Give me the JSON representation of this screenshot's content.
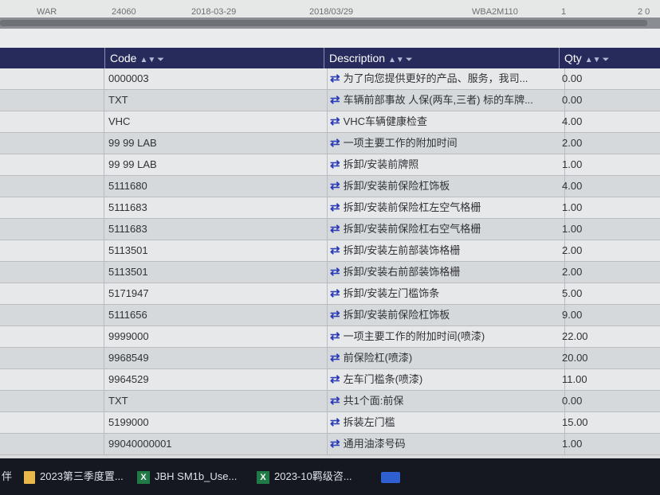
{
  "top_row": {
    "cells": [
      "WAR",
      "24060",
      "2018-03-29",
      "2018/03/29",
      "WBA2M110",
      "1",
      "2 0"
    ]
  },
  "columns": {
    "code": "Code",
    "description": "Description",
    "qty": "Qty"
  },
  "rows": [
    {
      "code": "0000003",
      "description": "为了向您提供更好的产品、服务，我司...",
      "qty": "0.00"
    },
    {
      "code": "TXT",
      "description": "车辆前部事故 人保(两车,三者) 标的车牌...",
      "qty": "0.00"
    },
    {
      "code": "VHC",
      "description": "VHC车辆健康检查",
      "qty": "4.00"
    },
    {
      "code": "99 99 LAB",
      "description": "一项主要工作的附加时间",
      "qty": "2.00"
    },
    {
      "code": "99 99 LAB",
      "description": "拆卸/安装前牌照",
      "qty": "1.00"
    },
    {
      "code": "5111680",
      "description": "拆卸/安装前保险杠饰板",
      "qty": "4.00"
    },
    {
      "code": "5111683",
      "description": "拆卸/安装前保险杠左空气格栅",
      "qty": "1.00"
    },
    {
      "code": "5111683",
      "description": "拆卸/安装前保险杠右空气格栅",
      "qty": "1.00"
    },
    {
      "code": "5113501",
      "description": "拆卸/安装左前部装饰格栅",
      "qty": "2.00"
    },
    {
      "code": "5113501",
      "description": "拆卸/安装右前部装饰格栅",
      "qty": "2.00"
    },
    {
      "code": "5171947",
      "description": "拆卸/安装左门槛饰条",
      "qty": "5.00"
    },
    {
      "code": "5111656",
      "description": "拆卸/安装前保险杠饰板",
      "qty": "9.00"
    },
    {
      "code": "9999000",
      "description": "一项主要工作的附加时间(喷漆)",
      "qty": "22.00"
    },
    {
      "code": "9968549",
      "description": "前保险杠(喷漆)",
      "qty": "20.00"
    },
    {
      "code": "9964529",
      "description": "左车门槛条(喷漆)",
      "qty": "11.00"
    },
    {
      "code": "TXT",
      "description": "共1个面:前保",
      "qty": "0.00"
    },
    {
      "code": "5199000",
      "description": "拆装左门槛",
      "qty": "15.00"
    },
    {
      "code": "99040000001",
      "description": "通用油漆号码",
      "qty": "1.00"
    }
  ],
  "taskbar": {
    "items": [
      {
        "label": "2023第三季度置...",
        "icon": "folder-icon"
      },
      {
        "label": "JBH SM1b_Use...",
        "icon": "excel-icon"
      },
      {
        "label": "2023-10羁级咨...",
        "icon": "excel-icon"
      }
    ],
    "left_glyph": "伴",
    "excel_glyph": "X"
  }
}
